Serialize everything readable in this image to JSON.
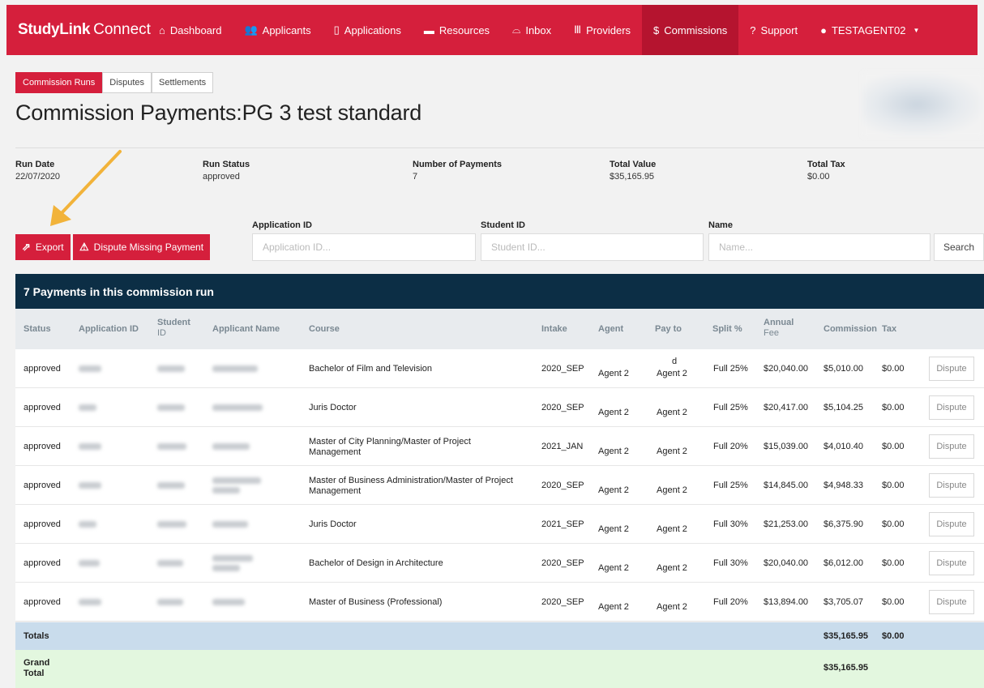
{
  "brand": {
    "name": "StudyLink",
    "suffix": "Connect"
  },
  "nav": {
    "items": [
      {
        "label": "Dashboard",
        "icon": "⌂"
      },
      {
        "label": "Applicants",
        "icon": "👥"
      },
      {
        "label": "Applications",
        "icon": "▯"
      },
      {
        "label": "Resources",
        "icon": "▬"
      },
      {
        "label": "Inbox",
        "icon": "⌓"
      },
      {
        "label": "Providers",
        "icon": "Ⅲ"
      },
      {
        "label": "Commissions",
        "icon": "$"
      },
      {
        "label": "Support",
        "icon": "?"
      },
      {
        "label": "TESTAGENT02",
        "icon": "●"
      }
    ]
  },
  "subtabs": [
    "Commission Runs",
    "Disputes",
    "Settlements"
  ],
  "page_title": "Commission Payments:PG 3 test standard",
  "stats": {
    "run_date_label": "Run Date",
    "run_date": "22/07/2020",
    "run_status_label": "Run Status",
    "run_status": "approved",
    "num_payments_label": "Number of Payments",
    "num_payments": "7",
    "total_value_label": "Total Value",
    "total_value": "$35,165.95",
    "total_tax_label": "Total Tax",
    "total_tax": "$0.00"
  },
  "actions": {
    "export": "Export",
    "dispute_missing": "Dispute Missing Payment"
  },
  "filters": {
    "app_id_label": "Application ID",
    "app_id_placeholder": "Application ID...",
    "student_id_label": "Student ID",
    "student_id_placeholder": "Student ID...",
    "name_label": "Name",
    "name_placeholder": "Name...",
    "search": "Search"
  },
  "table": {
    "title": "7 Payments in this commission run",
    "headers": {
      "status": "Status",
      "app_id": "Application ID",
      "student": "Student",
      "student_id": "ID",
      "name": "Applicant Name",
      "course": "Course",
      "intake": "Intake",
      "agent": "Agent",
      "payto": "Pay to",
      "split": "Split %",
      "fee_1": "Annual",
      "fee_2": "Fee",
      "commission": "Commission",
      "tax": "Tax"
    },
    "dispute_label": "Dispute",
    "rows": [
      {
        "status": "approved",
        "course": "Bachelor of Film and Television",
        "course2": "",
        "intake": "2020_SEP",
        "agent": "Agent 2",
        "payto_top": "d",
        "payto": "Agent 2",
        "split": "Full 25%",
        "fee": "$20,040.00",
        "commission": "$5,010.00",
        "tax": "$0.00"
      },
      {
        "status": "approved",
        "course": "Juris Doctor",
        "course2": "",
        "intake": "2020_SEP",
        "agent": "Agent 2",
        "payto_top": "",
        "payto": "Agent 2",
        "split": "Full 25%",
        "fee": "$20,417.00",
        "commission": "$5,104.25",
        "tax": "$0.00"
      },
      {
        "status": "approved",
        "course": "Master of City Planning/Master of Project",
        "course2": "Management",
        "intake": "2021_JAN",
        "agent": "Agent 2",
        "payto_top": "",
        "payto": "Agent 2",
        "split": "Full 20%",
        "fee": "$15,039.00",
        "commission": "$4,010.40",
        "tax": "$0.00"
      },
      {
        "status": "approved",
        "course": "Master of Business Administration/Master of Project",
        "course2": "Management",
        "intake": "2020_SEP",
        "agent": "Agent 2",
        "payto_top": "",
        "payto": "Agent 2",
        "split": "Full 25%",
        "fee": "$14,845.00",
        "commission": "$4,948.33",
        "tax": "$0.00"
      },
      {
        "status": "approved",
        "course": "Juris Doctor",
        "course2": "",
        "intake": "2021_SEP",
        "agent": "Agent 2",
        "payto_top": "",
        "payto": "Agent 2",
        "split": "Full 30%",
        "fee": "$21,253.00",
        "commission": "$6,375.90",
        "tax": "$0.00"
      },
      {
        "status": "approved",
        "course": "Bachelor of Design in Architecture",
        "course2": "",
        "intake": "2020_SEP",
        "agent": "Agent 2",
        "payto_top": "",
        "payto": "Agent 2",
        "split": "Full 30%",
        "fee": "$20,040.00",
        "commission": "$6,012.00",
        "tax": "$0.00"
      },
      {
        "status": "approved",
        "course": "Master of Business (Professional)",
        "course2": "",
        "intake": "2020_SEP",
        "agent": "Agent 2",
        "payto_top": "",
        "payto": "Agent 2",
        "split": "Full 20%",
        "fee": "$13,894.00",
        "commission": "$3,705.07",
        "tax": "$0.00"
      }
    ],
    "totals_label": "Totals",
    "totals_commission": "$35,165.95",
    "totals_tax": "$0.00",
    "grand_label_1": "Grand",
    "grand_label_2": "Total",
    "grand_commission": "$35,165.95"
  },
  "colors": {
    "brand_red": "#d51f3c",
    "nav_active": "#b5142f",
    "table_header": "#0c2e45",
    "totals_bg": "#c9dcec",
    "grand_bg": "#e3f7df",
    "arrow": "#f2b33a"
  }
}
